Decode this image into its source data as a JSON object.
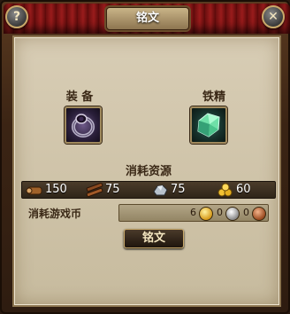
{
  "window": {
    "title": "铭文",
    "help_label": "?",
    "close_label": "✕"
  },
  "slots": {
    "equipment_label": "装 备",
    "material_label": "铁精",
    "equipment_icon": "ring-icon",
    "material_icon": "iron-essence-gem-icon"
  },
  "resources": {
    "header": "消耗资源",
    "items": [
      {
        "icon": "wood-icon",
        "value": "150"
      },
      {
        "icon": "timber-icon",
        "value": "75"
      },
      {
        "icon": "ore-icon",
        "value": "75"
      },
      {
        "icon": "gold-nuggets-icon",
        "value": "60"
      }
    ]
  },
  "currency": {
    "label": "消耗游戏币",
    "gold": "6",
    "silver": "0",
    "copper": "0"
  },
  "action": {
    "button_label": "铭文"
  },
  "colors": {
    "curtain_red": "#9a1c1c",
    "panel_parchment": "#d8cdb5",
    "frame_brown": "#3b2414",
    "button_gold_border": "#c9a96a"
  }
}
